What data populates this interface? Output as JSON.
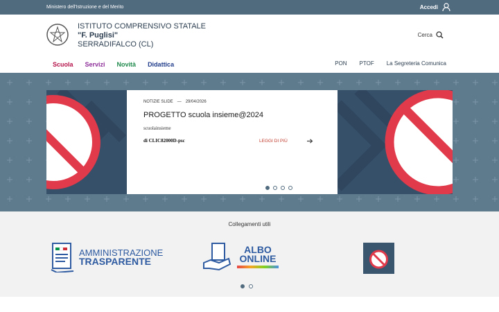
{
  "topbar": {
    "ministry": "Ministero dell'Istruzione e del Merito",
    "login_label": "Accedi"
  },
  "header": {
    "line1": "ISTITUTO COMPRENSIVO STATALE",
    "line2": "\"F. Puglisi\"",
    "line3": "SERRADIFALCO (CL)",
    "search_label": "Cerca"
  },
  "nav": {
    "main": [
      {
        "label": "Scuola",
        "color": "#b5124a"
      },
      {
        "label": "Servizi",
        "color": "#8e2f9a"
      },
      {
        "label": "Novità",
        "color": "#1f8a4c"
      },
      {
        "label": "Didattica",
        "color": "#1e3a8a"
      }
    ],
    "secondary": [
      "PON",
      "PTOF",
      "La Segreteria Comunica"
    ]
  },
  "slide": {
    "category": "NOTIZIE SLIDE",
    "separator": "—",
    "date": "29/04/2026",
    "title": "PROGETTO scuola insieme@2024",
    "subtitle": "scuolainsieme",
    "author": "di CLIC82000D-psc",
    "read_more": "LEGGI DI PIÙ"
  },
  "links": {
    "label": "Collegamenti utili",
    "at_line1": "AMMINISTRAZIONE",
    "at_line2": "TRASPARENTE",
    "albo_line1": "ALBO",
    "albo_line2": "ONLINE"
  },
  "icons": [
    "user-icon",
    "search-icon",
    "arrow-right-icon",
    "prohibited-icon",
    "emblem-icon"
  ]
}
